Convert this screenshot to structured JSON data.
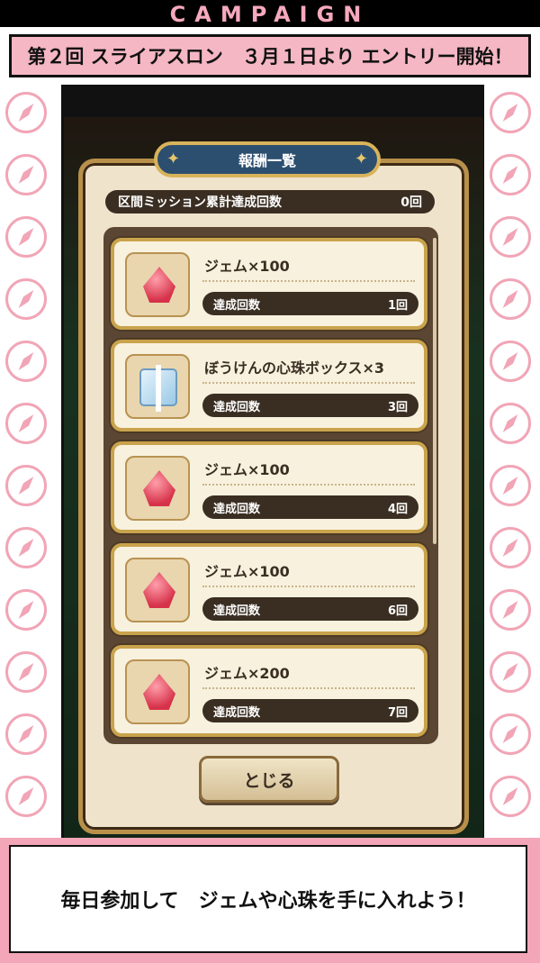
{
  "top": {
    "campaign_label": "CAMPAIGN"
  },
  "banner": {
    "text": "第２回 スライアスロン　３月１日より エントリー開始！"
  },
  "dialog": {
    "title": "報酬一覧",
    "summary": {
      "label": "区間ミッション累計達成回数",
      "value": "0回"
    },
    "items": [
      {
        "name": "ジェム×100",
        "count_label": "達成回数",
        "count": "1回",
        "icon": "gem-icon"
      },
      {
        "name": "ぼうけんの心珠ボックス×3",
        "count_label": "達成回数",
        "count": "3回",
        "icon": "gift-box-icon"
      },
      {
        "name": "ジェム×100",
        "count_label": "達成回数",
        "count": "4回",
        "icon": "gem-icon"
      },
      {
        "name": "ジェム×100",
        "count_label": "達成回数",
        "count": "6回",
        "icon": "gem-icon"
      },
      {
        "name": "ジェム×200",
        "count_label": "達成回数",
        "count": "7回",
        "icon": "gem-icon"
      }
    ],
    "close_label": "とじる"
  },
  "footer": {
    "text": "毎日参加して　ジェムや心珠を手に入れよう！"
  },
  "colors": {
    "pink": "#f4b7c3",
    "panel": "#efe4cb",
    "gold": "#c9a34c",
    "dark": "#3a2e22"
  }
}
